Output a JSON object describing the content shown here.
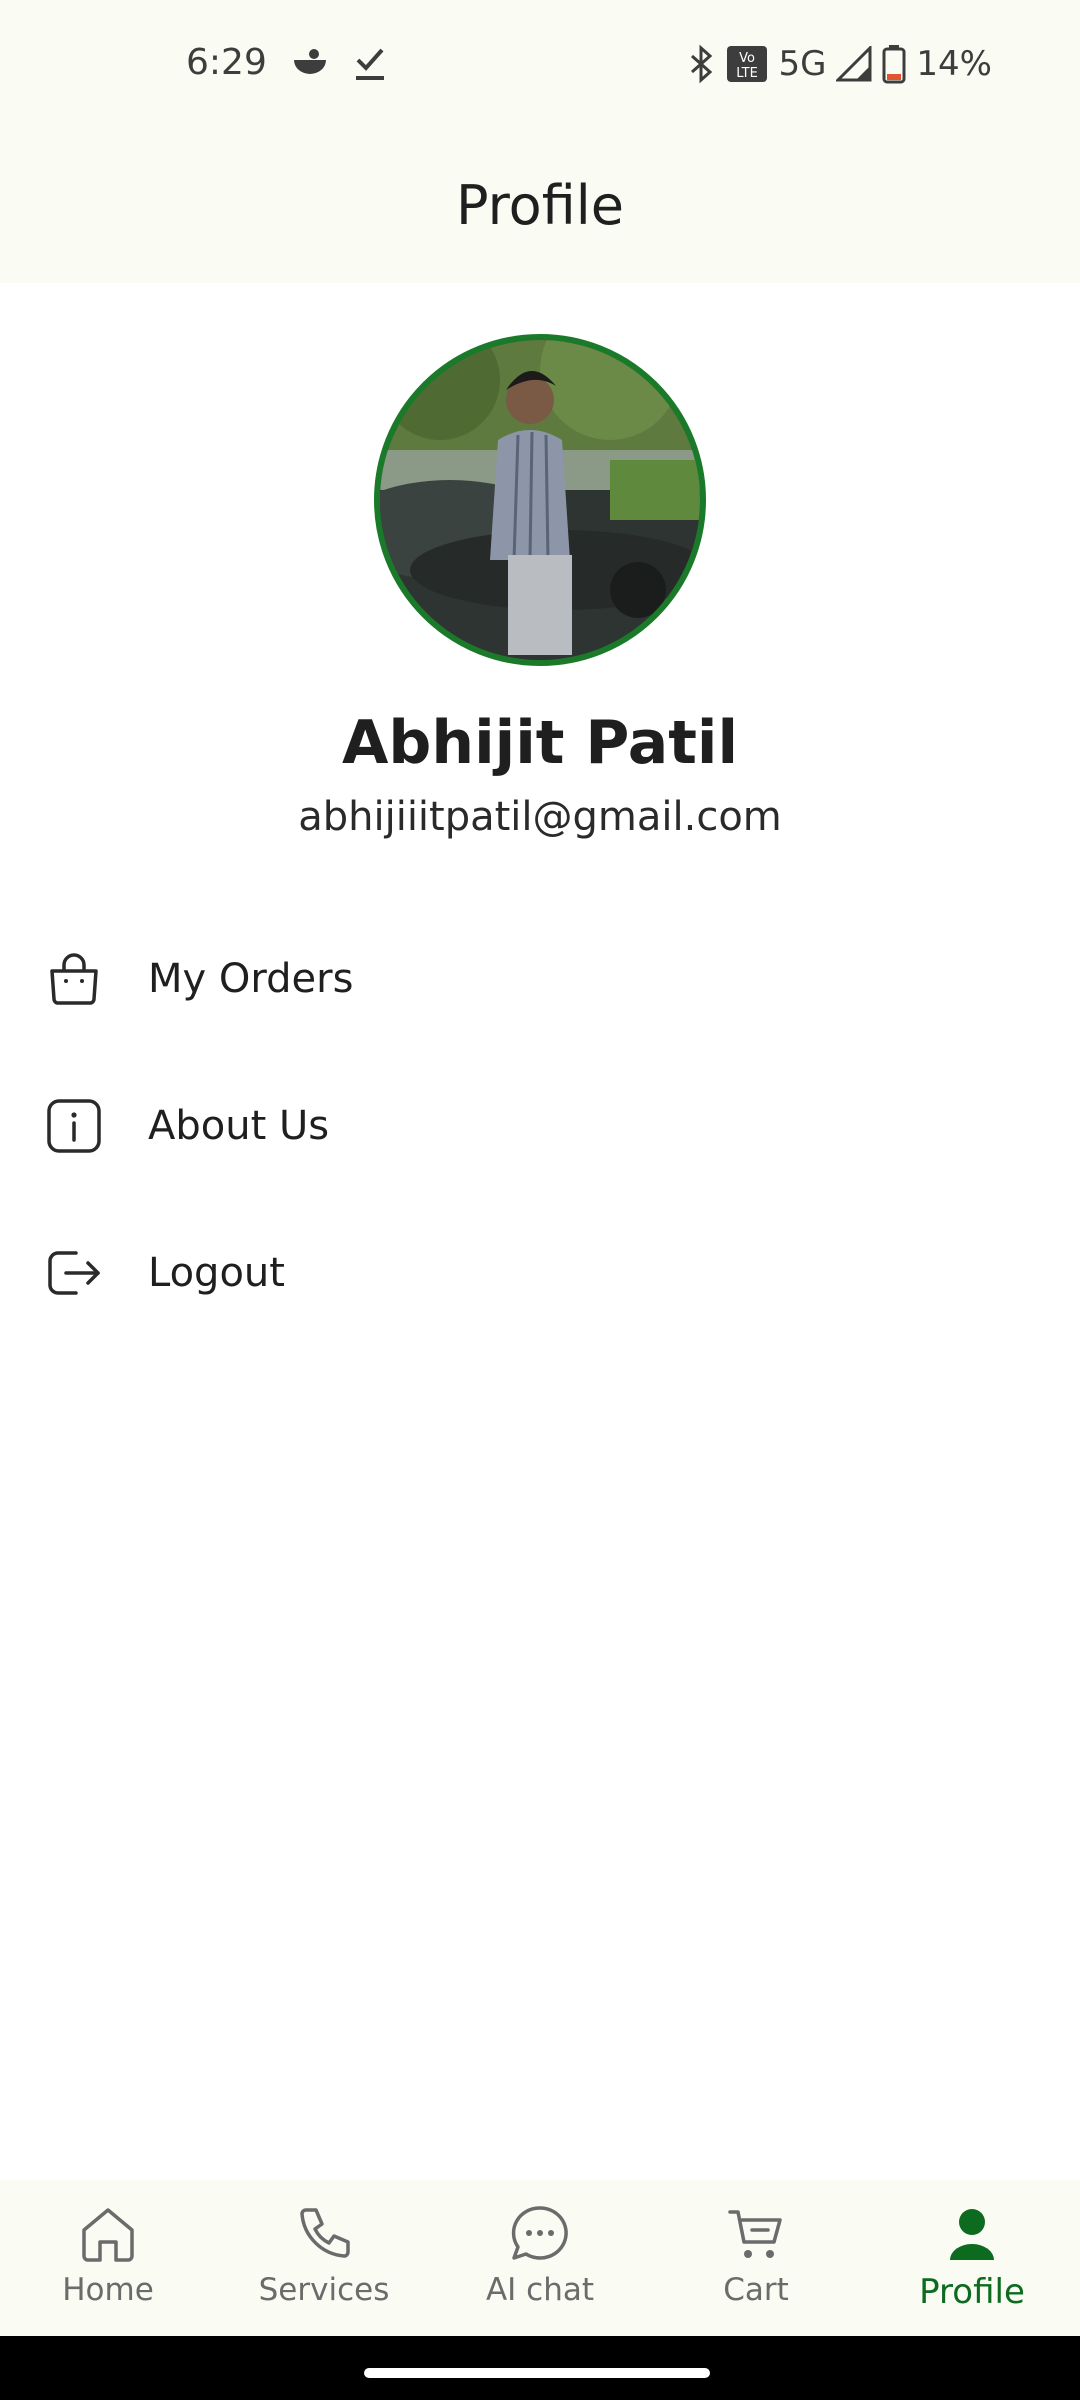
{
  "status_bar": {
    "time": "6:29",
    "network": "5G",
    "volte": "Vo LTE",
    "battery": "14%",
    "icons": [
      "app-notification-icon",
      "download-done-icon",
      "bluetooth-icon",
      "volte-icon",
      "signal-icon",
      "battery-icon"
    ]
  },
  "app_bar": {
    "title": "Profile"
  },
  "profile": {
    "name": "Abhijit Patil",
    "email": "abhijiiitpatil@gmail.com",
    "accent_color": "#1a7a2a"
  },
  "menu": {
    "items": [
      {
        "label": "My Orders",
        "icon": "shopping-bag-icon"
      },
      {
        "label": "About Us",
        "icon": "info-icon"
      },
      {
        "label": "Logout",
        "icon": "logout-icon"
      }
    ]
  },
  "bottom_nav": {
    "items": [
      {
        "label": "Home",
        "icon": "home-icon"
      },
      {
        "label": "Services",
        "icon": "phone-icon"
      },
      {
        "label": "AI chat",
        "icon": "chat-bubble-icon"
      },
      {
        "label": "Cart",
        "icon": "cart-icon"
      },
      {
        "label": "Profile",
        "icon": "person-icon",
        "active": true
      }
    ],
    "active_color": "#0c6b1f"
  }
}
